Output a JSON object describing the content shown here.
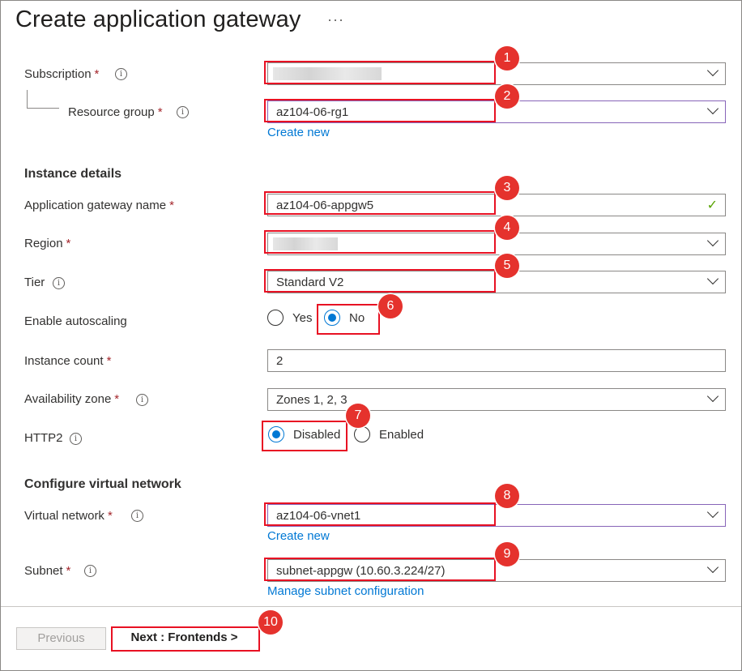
{
  "page": {
    "title": "Create application gateway",
    "more": "···"
  },
  "basics": {
    "subscription": {
      "label": "Subscription",
      "value": ""
    },
    "resource_group": {
      "label": "Resource group",
      "value": "az104-06-rg1",
      "create_new": "Create new"
    }
  },
  "instance": {
    "heading": "Instance details",
    "gateway_name": {
      "label": "Application gateway name",
      "value": "az104-06-appgw5"
    },
    "region": {
      "label": "Region",
      "value": ""
    },
    "tier": {
      "label": "Tier",
      "value": "Standard V2"
    },
    "autoscaling": {
      "label": "Enable autoscaling",
      "yes": "Yes",
      "no": "No",
      "selected": "No"
    },
    "instance_count": {
      "label": "Instance count",
      "value": "2"
    },
    "availability_zone": {
      "label": "Availability zone",
      "value": "Zones 1, 2, 3"
    },
    "http2": {
      "label": "HTTP2",
      "disabled": "Disabled",
      "enabled": "Enabled",
      "selected": "Disabled"
    }
  },
  "vnet": {
    "heading": "Configure virtual network",
    "virtual_network": {
      "label": "Virtual network",
      "value": "az104-06-vnet1",
      "create_new": "Create new"
    },
    "subnet": {
      "label": "Subnet",
      "value": "subnet-appgw (10.60.3.224/27)",
      "manage": "Manage subnet configuration"
    }
  },
  "footer": {
    "previous": "Previous",
    "next": "Next : Frontends >"
  },
  "required_mark": "*",
  "info_glyph": "i",
  "annotations": [
    "1",
    "2",
    "3",
    "4",
    "5",
    "6",
    "7",
    "8",
    "9",
    "10"
  ],
  "colors": {
    "accent": "#0078d4",
    "required": "#a4262c",
    "annotation": "#e81123",
    "valid": "#57a300"
  }
}
